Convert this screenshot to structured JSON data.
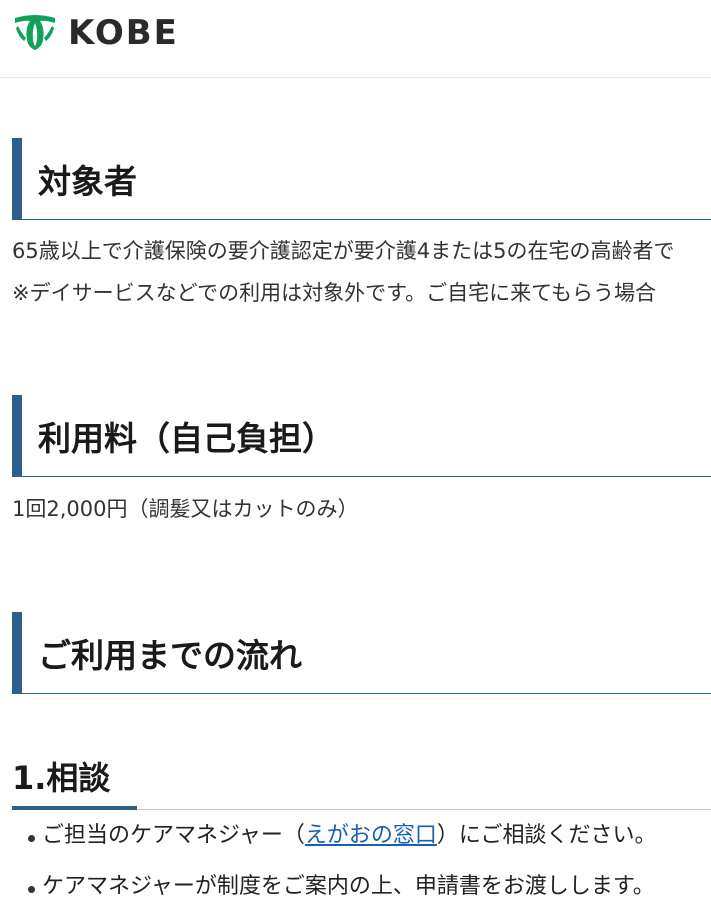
{
  "header": {
    "logo_text": "KOBE",
    "logo_color": "#12a05a"
  },
  "sections": {
    "target": {
      "title": "対象者",
      "line1": "65歳以上で介護保険の要介護認定が要介護4または5の在宅の高齢者で",
      "line2": "※デイサービスなどでの利用は対象外です。ご自宅に来てもらう場合"
    },
    "fee": {
      "title": "利用料（自己負担）",
      "text": "1回2,000円（調髪又はカットのみ）"
    },
    "flow": {
      "title": "ご利用までの流れ",
      "step1": {
        "title": "1.相談",
        "item1_before": "ご担当のケアマネジャー（",
        "item1_link": "えがおの窓口",
        "item1_after": "）にご相談ください。",
        "item2": "ケアマネジャーが制度をご案内の上、申請書をお渡しします。"
      }
    }
  },
  "colors": {
    "accent": "#2e5e8c",
    "link": "#1a5fb4"
  }
}
